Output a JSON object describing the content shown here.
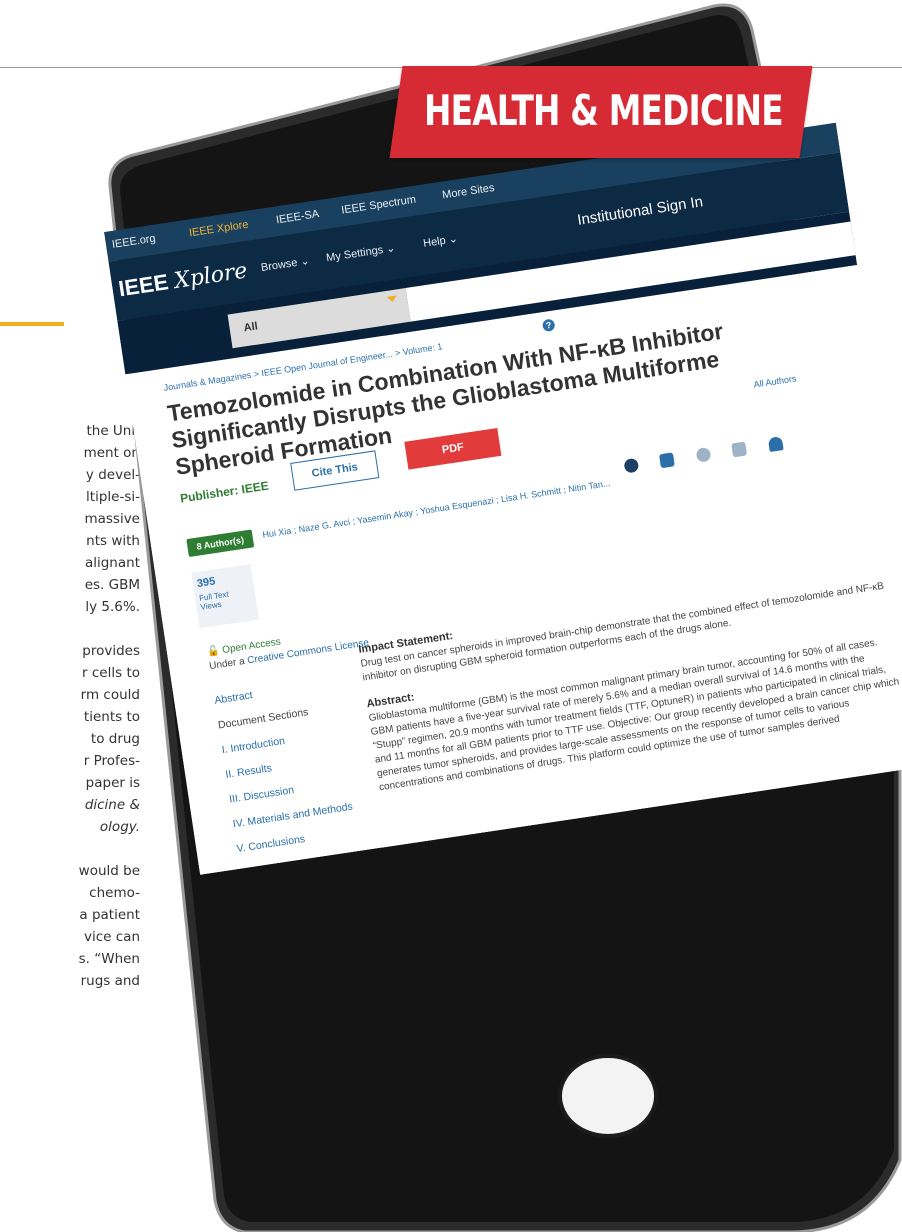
{
  "article": {
    "lines": [
      "the Uni-",
      "ment on",
      "y devel-",
      "ltiple-si-",
      "massive",
      "nts with",
      "alignant",
      "es. GBM",
      "ly 5.6%.",
      "",
      "provides",
      "r cells to",
      "rm could",
      "tients to",
      "to drug",
      "r Profes-",
      "paper is",
      "dicine &",
      "ology.",
      "",
      "would be",
      "chemo-",
      "a patient",
      "vice can",
      "s. “When",
      "rugs and"
    ]
  },
  "banner": {
    "label": "HEALTH & MEDICINE"
  },
  "ieee": {
    "top_links": [
      "IEEE.org",
      "IEEE Xplore",
      "IEEE-SA",
      "IEEE Spectrum",
      "More Sites"
    ],
    "logo_bold": "IEEE",
    "logo_italic": "Xplore",
    "nav": [
      "Browse ⌄",
      "My Settings ⌄",
      "Help ⌄"
    ],
    "signin": "Institutional Sign In",
    "search_scope": "All"
  },
  "paper": {
    "breadcrumb": "Journals & Magazines > IEEE Open Journal of Engineer... > Volume: 1",
    "title": "Temozolomide in Combination With NF-κB Inhibitor Significantly Disrupts the Glioblastoma Multiforme Spheroid Formation",
    "publisher": "Publisher: IEEE",
    "cite_label": "Cite This",
    "pdf_label": "PDF",
    "all_authors": "All Authors",
    "authors_badge": "8 Author(s)",
    "authors": "Hui Xia ; Naze G. Avci ; Yasemin Akay ; Yoshua Esquenazi ; Lisa H. Schmitt ; Nitin Tan...",
    "views_count": "395",
    "views_label": "Full Text Views",
    "open_access": "Open Access",
    "license_prefix": "Under a ",
    "license_link": "Creative Commons License",
    "sidebar": {
      "abstract": "Abstract",
      "sections_heading": "Document Sections",
      "sections": [
        "I. Introduction",
        "II. Results",
        "III. Discussion",
        "IV. Materials and Methods",
        "V. Conclusions"
      ]
    },
    "impact_heading": "Impact Statement:",
    "impact_text": "Drug test on cancer spheroids in improved brain-chip demonstrate that the combined effect of temozolomide and NF-κB inhibitor on disrupting GBM spheroid formation outperforms each of the drugs alone.",
    "abstract_heading": "Abstract:",
    "abstract_text": "Glioblastoma multiforme (GBM) is the most common malignant primary brain tumor, accounting for 50% of all cases. GBM patients have a five-year survival rate of merely 5.6% and a median overall survival of 14.6 months with the “Stupp” regimen, 20.9 months with tumor treatment fields (TTF, OptuneR) in patients who participated in clinical trials, and 11 months for all GBM patients prior to TTF use. Objective: Our group recently developed a brain cancer chip which generates tumor spheroids, and provides large-scale assessments on the response of tumor cells to various concentrations and combinations of drugs. This platform could optimize the use of tumor samples derived"
  },
  "colors": {
    "banner": "#d62b35",
    "ieee_navy": "#0d2a44",
    "link_blue": "#2a6fa9",
    "accent_gold": "#f0ae24"
  }
}
